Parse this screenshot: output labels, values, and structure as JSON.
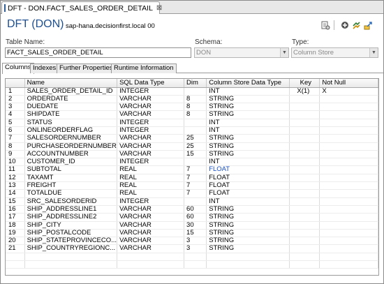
{
  "editor_tab": {
    "label": "DFT - DON.FACT_SALES_ORDER_DETAIL",
    "close": "⊠"
  },
  "header": {
    "title": "DFT (DON)",
    "host": "sap-hana.decisionfirst.local 00"
  },
  "toolbar": {
    "icons": [
      "data-preview-icon",
      "activate-icon",
      "add-icon",
      "refresh-icon",
      "export-icon"
    ]
  },
  "fields": {
    "table_name_label": "Table Name:",
    "table_name_value": "FACT_SALES_ORDER_DETAIL",
    "schema_label": "Schema:",
    "schema_value": "DON",
    "type_label": "Type:",
    "type_value": "Column Store"
  },
  "tabs": [
    "Columns",
    "Indexes",
    "Further Properties",
    "Runtime Information"
  ],
  "table": {
    "headers": [
      "",
      "Name",
      "SQL Data Type",
      "Dim",
      "Column Store Data Type",
      "Key",
      "Not Null"
    ],
    "rows": [
      [
        "1",
        "SALES_ORDER_DETAIL_ID",
        "INTEGER",
        "",
        "INT",
        "X(1)",
        "X"
      ],
      [
        "2",
        "ORDERDATE",
        "VARCHAR",
        "8",
        "STRING",
        "",
        ""
      ],
      [
        "3",
        "DUEDATE",
        "VARCHAR",
        "8",
        "STRING",
        "",
        ""
      ],
      [
        "4",
        "SHIPDATE",
        "VARCHAR",
        "8",
        "STRING",
        "",
        ""
      ],
      [
        "5",
        "STATUS",
        "INTEGER",
        "",
        "INT",
        "",
        ""
      ],
      [
        "6",
        "ONLINEORDERFLAG",
        "INTEGER",
        "",
        "INT",
        "",
        ""
      ],
      [
        "7",
        "SALESORDERNUMBER",
        "VARCHAR",
        "25",
        "STRING",
        "",
        ""
      ],
      [
        "8",
        "PURCHASEORDERNUMBER",
        "VARCHAR",
        "25",
        "STRING",
        "",
        ""
      ],
      [
        "9",
        "ACCOUNTNUMBER",
        "VARCHAR",
        "15",
        "STRING",
        "",
        ""
      ],
      [
        "10",
        "CUSTOMER_ID",
        "INTEGER",
        "",
        "INT",
        "",
        ""
      ],
      [
        "11",
        "SUBTOTAL",
        "REAL",
        "7",
        "FLOAT",
        "",
        ""
      ],
      [
        "12",
        "TAXAMT",
        "REAL",
        "7",
        "FLOAT",
        "",
        ""
      ],
      [
        "13",
        "FREIGHT",
        "REAL",
        "7",
        "FLOAT",
        "",
        ""
      ],
      [
        "14",
        "TOTALDUE",
        "REAL",
        "7",
        "FLOAT",
        "",
        ""
      ],
      [
        "15",
        "SRC_SALESORDERID",
        "INTEGER",
        "",
        "INT",
        "",
        ""
      ],
      [
        "16",
        "SHIP_ADDRESSLINE1",
        "VARCHAR",
        "60",
        "STRING",
        "",
        ""
      ],
      [
        "17",
        "SHIP_ADDRESSLINE2",
        "VARCHAR",
        "60",
        "STRING",
        "",
        ""
      ],
      [
        "18",
        "SHIP_CITY",
        "VARCHAR",
        "30",
        "STRING",
        "",
        ""
      ],
      [
        "19",
        "SHIP_POSTALCODE",
        "VARCHAR",
        "15",
        "STRING",
        "",
        ""
      ],
      [
        "20",
        "SHIP_STATEPROVINCECO...",
        "VARCHAR",
        "3",
        "STRING",
        "",
        ""
      ],
      [
        "21",
        "SHIP_COUNTRYREGIONC...",
        "VARCHAR",
        "3",
        "STRING",
        "",
        ""
      ]
    ],
    "empty_rows": 2
  },
  "colors": {
    "title": "#1d4f91",
    "float_highlight": "#1a4fc4"
  }
}
